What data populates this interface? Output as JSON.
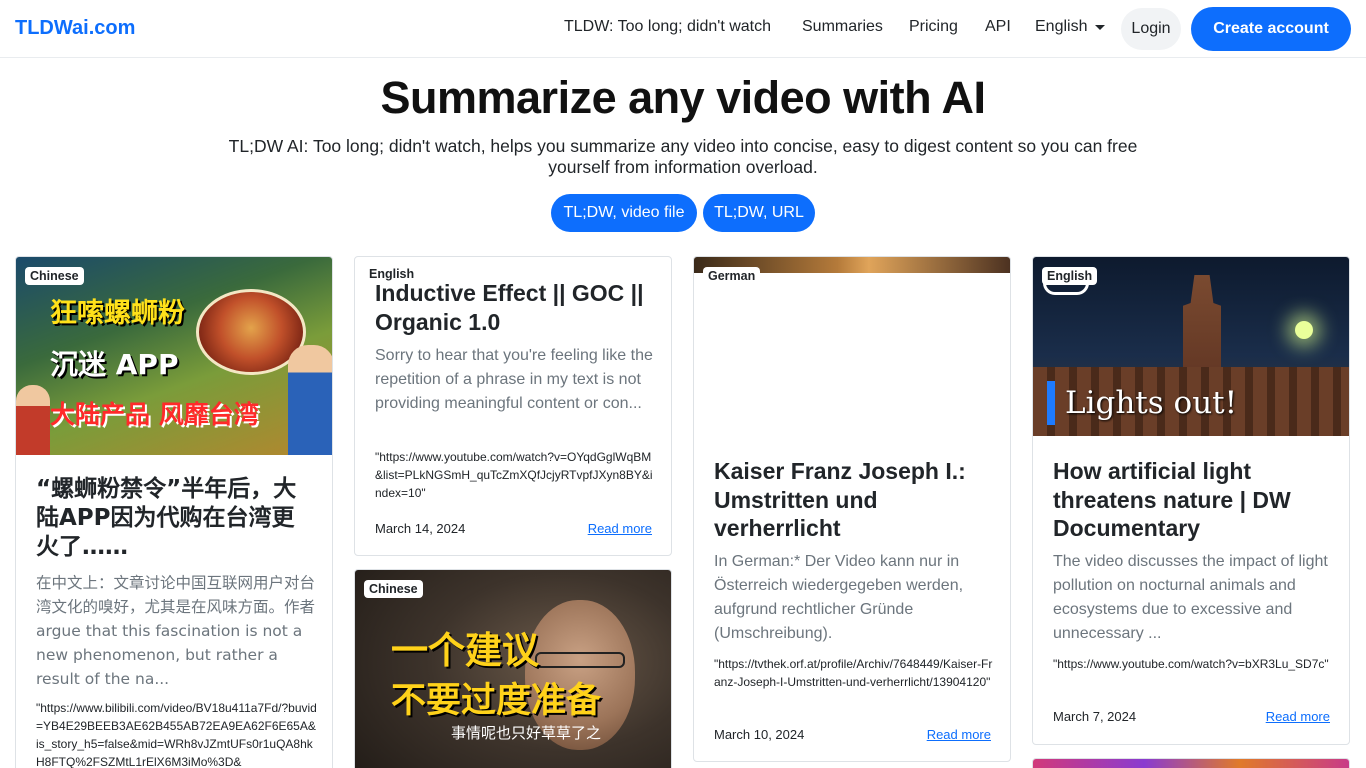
{
  "nav": {
    "brand": "TLDWai.com",
    "links": [
      "TLDW: Too long; didn't watch",
      "Summaries",
      "Pricing",
      "API"
    ],
    "language": "English",
    "login": "Login",
    "create_account": "Create account"
  },
  "hero": {
    "title": "Summarize any video with AI",
    "subtitle": "TL;DW AI: Too long; didn't watch, helps you summarize any video into concise, easy to digest content so you can free yourself from information overload.",
    "btn_file": "TL;DW, video file",
    "btn_url": "TL;DW, URL"
  },
  "cards": [
    {
      "language": "Chinese",
      "thumb_text": [
        "狂嗦螺蛳粉",
        "沉迷 APP",
        "大陆产品 风靡台湾"
      ],
      "title": "“螺蛳粉禁令”半年后，大陆APP因为代购在台湾更火了……",
      "description": "在中文上：文章讨论中国互联网用户对台湾文化的嗅好，尤其是在风味方面。作者 argue that this fascination is not a new phenomenon, but rather a result of the na...",
      "url": "\"https://www.bilibili.com/video/BV18u411a7Fd/?buvid=YB4E29BEEB3AE62B455AB72EA9EA62F6E65A&is_story_h5=false&mid=WRh8vJZmtUFs0r1uQA8hkH8FTQ%2FSZMtL1rElX6M3iMo%3D&"
    },
    {
      "language": "English",
      "title": "Inductive Effect || GOC || Organic 1.0",
      "description": "Sorry to hear that you're feeling like the repetition of a phrase in my text is not providing meaningful content or con...",
      "url": "\"https://www.youtube.com/watch?v=OYqdGglWqBM&list=PLkNGSmH_quTcZmXQfJcjyRTvpfJXyn8BY&index=10\"",
      "date": "March 14, 2024",
      "read_more": "Read more"
    },
    {
      "language": "Chinese",
      "thumb_text": [
        "一个建议",
        "不要过度准备",
        "事情呢也只好草草了之"
      ]
    },
    {
      "language": "German",
      "title": "Kaiser Franz Joseph I.: Umstritten und verherrlicht",
      "description": "In German:* Der Video kann nur in Österreich wiedergegeben werden, aufgrund rechtlicher Gründe (Umschreibung).",
      "url": "\"https://tvthek.orf.at/profile/Archiv/7648449/Kaiser-Franz-Joseph-I-Umstritten-und-verherrlicht/13904120\"",
      "date": "March 10, 2024",
      "read_more": "Read more"
    },
    {
      "language": "English",
      "thumb_text": "Lights out!",
      "title": "How artificial light threatens nature | DW Documentary",
      "description": "The video discusses the impact of light pollution on nocturnal animals and ecosystems due to excessive and unnecessary ...",
      "url": "\"https://www.youtube.com/watch?v=bXR3Lu_SD7c\"",
      "date": "March 7, 2024",
      "read_more": "Read more"
    }
  ],
  "colors": {
    "brand": "#0d6efd",
    "text": "#212529",
    "muted": "#6c757d"
  }
}
